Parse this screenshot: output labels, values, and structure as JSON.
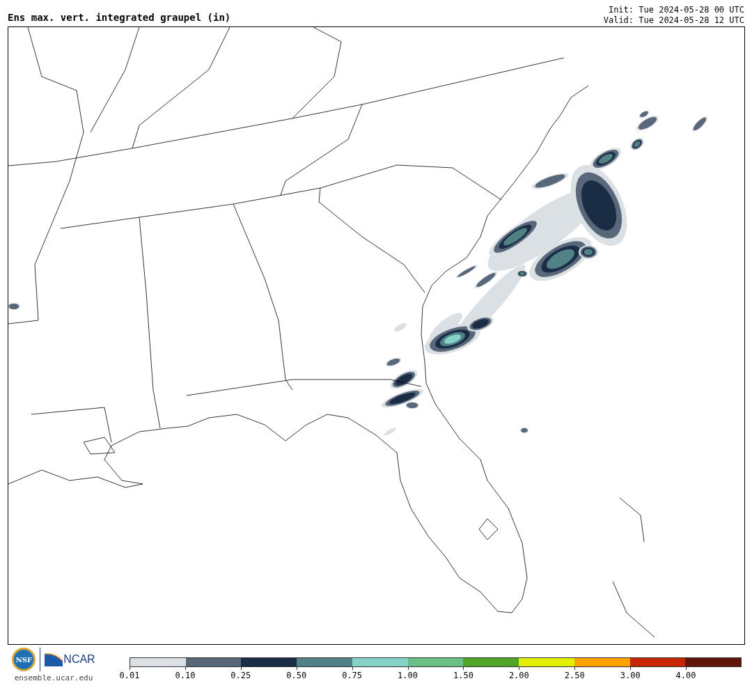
{
  "header": {
    "title": "Ens max. vert. integrated graupel (in)",
    "init": "Init: Tue 2024-05-28 00 UTC",
    "valid": "Valid: Tue 2024-05-28 12 UTC"
  },
  "logos": {
    "nsf": "NSF",
    "ncar": "NCAR",
    "website": "ensemble.ucar.edu"
  },
  "colorbar": {
    "bins": [
      {
        "label": "0.01",
        "color": "#dbe0e4"
      },
      {
        "label": "0.10",
        "color": "#58677a"
      },
      {
        "label": "0.25",
        "color": "#1b2d45"
      },
      {
        "label": "0.50",
        "color": "#4f8185"
      },
      {
        "label": "0.75",
        "color": "#86d2c8"
      },
      {
        "label": "1.00",
        "color": "#6bbf84"
      },
      {
        "label": "1.50",
        "color": "#52a426"
      },
      {
        "label": "2.00",
        "color": "#e2f000"
      },
      {
        "label": "2.50",
        "color": "#ffa100"
      },
      {
        "label": "3.00",
        "color": "#c42600"
      },
      {
        "label": "4.00",
        "color": "#5f170b"
      }
    ]
  }
}
